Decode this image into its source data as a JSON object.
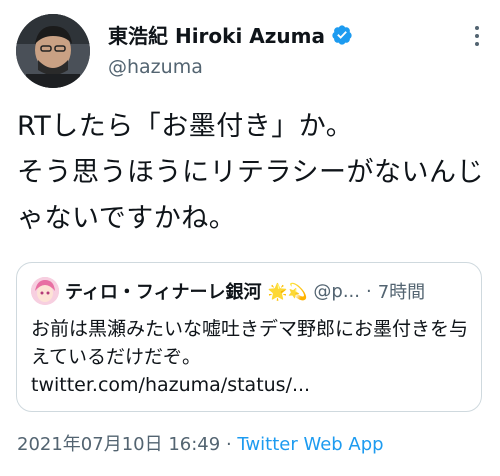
{
  "author": {
    "display_name": "東浩紀 Hiroki Azuma",
    "handle": "@hazuma",
    "verified_icon": "verified-badge-icon",
    "verified_color": "#1d9bf0"
  },
  "tweet": {
    "text": "RTしたら「お墨付き」か。\nそう思うほうにリテラシーがないんじゃないですかね。",
    "timestamp": "2021年07月10日 16:49",
    "separator": "·",
    "source": "Twitter Web App"
  },
  "quoted": {
    "display_name": "ティロ・フィナーレ銀河",
    "emoji": "🌟💫",
    "handle": "@p...",
    "separator": "·",
    "time": "7時間",
    "text": "お前は黒瀬みたいな嘘吐きデマ野郎にお墨付きを与えているだけだぞ。 twitter.com/hazuma/status/..."
  },
  "colors": {
    "primary_text": "#0f1419",
    "secondary_text": "#536471",
    "link": "#1d9bf0",
    "border": "#cfd9de"
  }
}
